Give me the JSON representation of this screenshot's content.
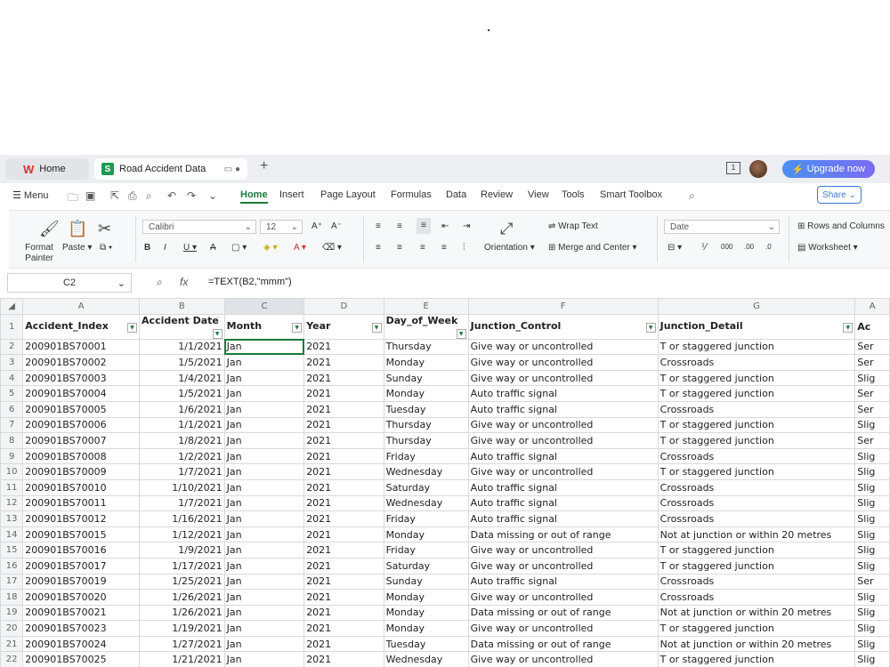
{
  "tabs": {
    "home_label": "Home",
    "doc_label": "Road Accident Data"
  },
  "window": {
    "upgrade_label": "Upgrade now",
    "num_box": "1"
  },
  "menu": {
    "menu_label": "Menu",
    "items": [
      "Home",
      "Insert",
      "Page Layout",
      "Formulas",
      "Data",
      "Review",
      "View",
      "Tools",
      "Smart Toolbox"
    ],
    "share_label": "Share"
  },
  "ribbon": {
    "format_painter": "Format Painter",
    "paste": "Paste",
    "font_name": "Calibri",
    "font_size": "12",
    "wrap_text": "Wrap Text",
    "orientation": "Orientation",
    "merge_center": "Merge and Center",
    "number_format": "Date",
    "rows_columns": "Rows and Columns",
    "worksheet": "Worksheet"
  },
  "formula_bar": {
    "cell_ref": "C2",
    "fx": "fx",
    "formula": "=TEXT(B2,\"mmm\")"
  },
  "sheet": {
    "col_letters": [
      "A",
      "B",
      "C",
      "D",
      "E",
      "F",
      "G",
      "A"
    ],
    "headers": [
      "Accident_Index",
      "Accident Date",
      "Month",
      "Year",
      "Day_of_Week",
      "Junction_Control",
      "Junction_Detail",
      "Ac"
    ],
    "rows": [
      [
        "2",
        "200901BS70001",
        "1/1/2021",
        "Jan",
        "2021",
        "Thursday",
        "Give way or uncontrolled",
        "T or staggered junction",
        "Ser"
      ],
      [
        "3",
        "200901BS70002",
        "1/5/2021",
        "Jan",
        "2021",
        "Monday",
        "Give way or uncontrolled",
        "Crossroads",
        "Ser"
      ],
      [
        "4",
        "200901BS70003",
        "1/4/2021",
        "Jan",
        "2021",
        "Sunday",
        "Give way or uncontrolled",
        "T or staggered junction",
        "Slig"
      ],
      [
        "5",
        "200901BS70004",
        "1/5/2021",
        "Jan",
        "2021",
        "Monday",
        "Auto traffic signal",
        "T or staggered junction",
        "Ser"
      ],
      [
        "6",
        "200901BS70005",
        "1/6/2021",
        "Jan",
        "2021",
        "Tuesday",
        "Auto traffic signal",
        "Crossroads",
        "Ser"
      ],
      [
        "7",
        "200901BS70006",
        "1/1/2021",
        "Jan",
        "2021",
        "Thursday",
        "Give way or uncontrolled",
        "T or staggered junction",
        "Slig"
      ],
      [
        "8",
        "200901BS70007",
        "1/8/2021",
        "Jan",
        "2021",
        "Thursday",
        "Give way or uncontrolled",
        "T or staggered junction",
        "Ser"
      ],
      [
        "9",
        "200901BS70008",
        "1/2/2021",
        "Jan",
        "2021",
        "Friday",
        "Auto traffic signal",
        "Crossroads",
        "Slig"
      ],
      [
        "10",
        "200901BS70009",
        "1/7/2021",
        "Jan",
        "2021",
        "Wednesday",
        "Give way or uncontrolled",
        "T or staggered junction",
        "Slig"
      ],
      [
        "11",
        "200901BS70010",
        "1/10/2021",
        "Jan",
        "2021",
        "Saturday",
        "Auto traffic signal",
        "Crossroads",
        "Slig"
      ],
      [
        "12",
        "200901BS70011",
        "1/7/2021",
        "Jan",
        "2021",
        "Wednesday",
        "Auto traffic signal",
        "Crossroads",
        "Slig"
      ],
      [
        "13",
        "200901BS70012",
        "1/16/2021",
        "Jan",
        "2021",
        "Friday",
        "Auto traffic signal",
        "Crossroads",
        "Slig"
      ],
      [
        "14",
        "200901BS70015",
        "1/12/2021",
        "Jan",
        "2021",
        "Monday",
        "Data missing or out of range",
        "Not at junction or within 20 metres",
        "Slig"
      ],
      [
        "15",
        "200901BS70016",
        "1/9/2021",
        "Jan",
        "2021",
        "Friday",
        "Give way or uncontrolled",
        "T or staggered junction",
        "Slig"
      ],
      [
        "16",
        "200901BS70017",
        "1/17/2021",
        "Jan",
        "2021",
        "Saturday",
        "Give way or uncontrolled",
        "T or staggered junction",
        "Slig"
      ],
      [
        "17",
        "200901BS70019",
        "1/25/2021",
        "Jan",
        "2021",
        "Sunday",
        "Auto traffic signal",
        "Crossroads",
        "Ser"
      ],
      [
        "18",
        "200901BS70020",
        "1/26/2021",
        "Jan",
        "2021",
        "Monday",
        "Give way or uncontrolled",
        "Crossroads",
        "Slig"
      ],
      [
        "19",
        "200901BS70021",
        "1/26/2021",
        "Jan",
        "2021",
        "Monday",
        "Data missing or out of range",
        "Not at junction or within 20 metres",
        "Slig"
      ],
      [
        "20",
        "200901BS70023",
        "1/19/2021",
        "Jan",
        "2021",
        "Monday",
        "Give way or uncontrolled",
        "T or staggered junction",
        "Slig"
      ],
      [
        "21",
        "200901BS70024",
        "1/27/2021",
        "Jan",
        "2021",
        "Tuesday",
        "Data missing or out of range",
        "Not at junction or within 20 metres",
        "Slig"
      ],
      [
        "22",
        "200901BS70025",
        "1/21/2021",
        "Jan",
        "2021",
        "Wednesday",
        "Give way or uncontrolled",
        "T or staggered junction",
        "Slig"
      ]
    ]
  },
  "colors": {
    "accent": "#1a7a3c",
    "upgrade": "#4a8ff5"
  }
}
